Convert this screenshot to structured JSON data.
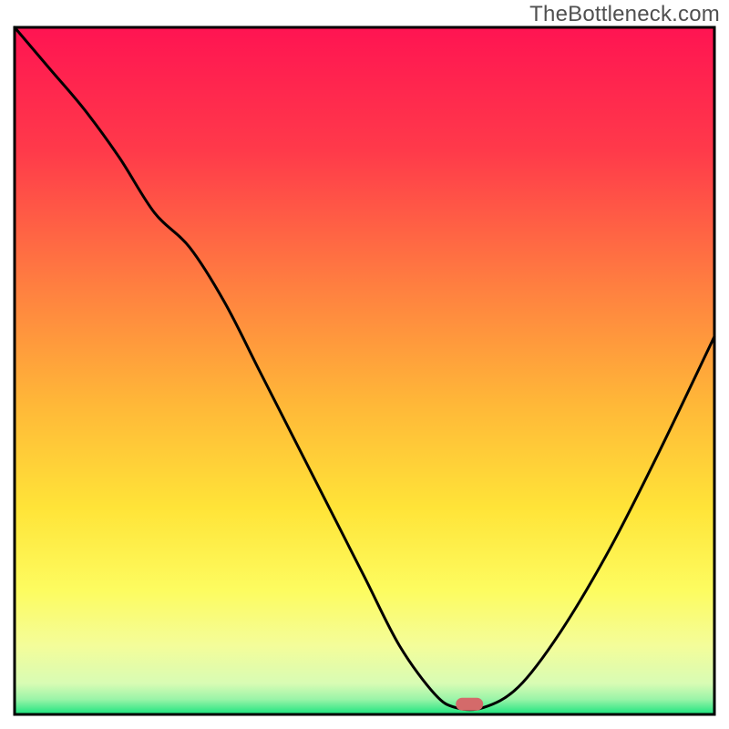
{
  "watermark": "TheBottleneck.com",
  "chart_data": {
    "type": "line",
    "title": "",
    "xlabel": "",
    "ylabel": "",
    "xlim": [
      0,
      100
    ],
    "ylim": [
      0,
      100
    ],
    "series": [
      {
        "name": "curve",
        "x": [
          0,
          5,
          10,
          15,
          20,
          25,
          30,
          35,
          40,
          45,
          50,
          55,
          60,
          63,
          67,
          72,
          78,
          85,
          92,
          100
        ],
        "y": [
          100,
          94,
          88,
          81,
          73,
          68,
          60,
          50,
          40,
          30,
          20,
          10,
          3,
          1,
          1,
          4,
          12,
          24,
          38,
          55
        ]
      }
    ],
    "marker": {
      "x": 65,
      "y": 1.5
    },
    "gradient_stops": [
      {
        "offset": 0.0,
        "color": "#ff1452"
      },
      {
        "offset": 0.18,
        "color": "#ff3a4a"
      },
      {
        "offset": 0.38,
        "color": "#ff8040"
      },
      {
        "offset": 0.55,
        "color": "#ffb838"
      },
      {
        "offset": 0.7,
        "color": "#ffe438"
      },
      {
        "offset": 0.82,
        "color": "#fdfc60"
      },
      {
        "offset": 0.9,
        "color": "#f4fd9a"
      },
      {
        "offset": 0.955,
        "color": "#d8fcb4"
      },
      {
        "offset": 0.978,
        "color": "#9af4a8"
      },
      {
        "offset": 1.0,
        "color": "#1ae47e"
      }
    ],
    "frame_color": "#000000",
    "marker_color": "#d46a6a"
  }
}
